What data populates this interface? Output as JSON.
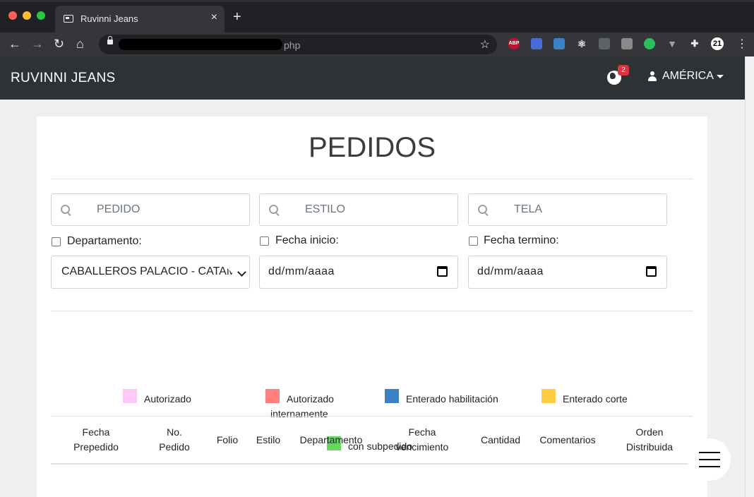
{
  "browser": {
    "tab_title": "Ruvinni Jeans",
    "tab_close": "×",
    "new_tab": "+",
    "url_visible": "php",
    "extensions": [
      "abp-icon",
      "extension-icon",
      "search-extension-icon",
      "react-icon",
      "lightbulb-icon",
      "window-icon",
      "evernote-icon",
      "vue-icon",
      "puzzle-icon",
      "badge-21-icon"
    ],
    "abp_label": "ABP",
    "badge_21": "21"
  },
  "navbar": {
    "brand": "RUVINNI JEANS",
    "notification_count": "2",
    "user_name": "AMÉRICA"
  },
  "main": {
    "title": "PEDIDOS",
    "searches": [
      {
        "placeholder": "PEDIDO"
      },
      {
        "placeholder": "ESTILO"
      },
      {
        "placeholder": "TELA"
      }
    ],
    "filters": {
      "departamento_label": "Departamento:",
      "fecha_inicio_label": "Fecha inicio:",
      "fecha_termino_label": "Fecha termino:",
      "departamento_value": "CABALLEROS PALACIO - CATAM",
      "fecha_inicio_value": "dd/mm/aaaa",
      "fecha_termino_value": "dd/mm/aaaa"
    },
    "legend": [
      {
        "label": "Autorizado",
        "color": "#ffc9f7"
      },
      {
        "label_line1": "Autorizado",
        "label_line2": "internamente",
        "color": "#ff8080"
      },
      {
        "label": "Enterado habilitación",
        "color": "#3b82c4"
      },
      {
        "label": "Enterado corte",
        "color": "#ffcc44"
      },
      {
        "label": "con subpedido",
        "color": "#66d95c"
      }
    ],
    "table_headers": [
      {
        "line1": "Fecha",
        "line2": "Prepedido"
      },
      {
        "line1": "No.",
        "line2": "Pedido"
      },
      {
        "line1": "Folio",
        "line2": ""
      },
      {
        "line1": "Estilo",
        "line2": ""
      },
      {
        "line1": "Departamento",
        "line2": ""
      },
      {
        "line1": "Fecha",
        "line2": "vencimiento"
      },
      {
        "line1": "Cantidad",
        "line2": ""
      },
      {
        "line1": "Comentarios",
        "line2": ""
      },
      {
        "line1": "Orden",
        "line2": "Distribuida"
      }
    ]
  }
}
